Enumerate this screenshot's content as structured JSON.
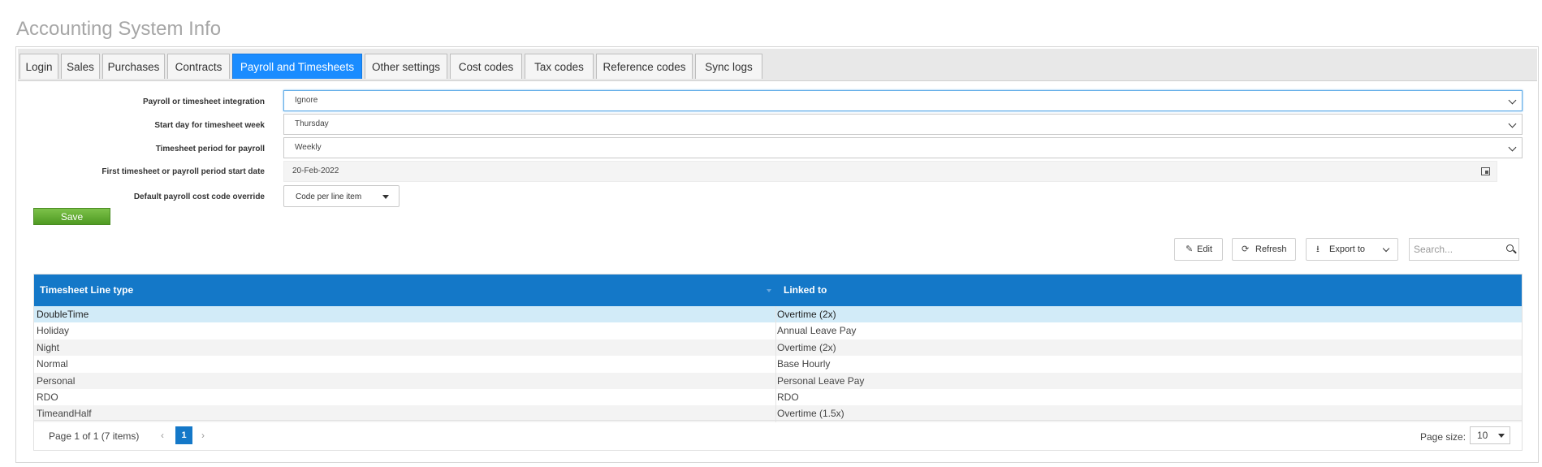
{
  "page": {
    "title": "Accounting System Info"
  },
  "tabs": [
    {
      "label": "Login",
      "active": false
    },
    {
      "label": "Sales",
      "active": false
    },
    {
      "label": "Purchases",
      "active": false
    },
    {
      "label": "Contracts",
      "active": false
    },
    {
      "label": "Payroll and Timesheets",
      "active": true
    },
    {
      "label": "Other settings",
      "active": false
    },
    {
      "label": "Cost codes",
      "active": false
    },
    {
      "label": "Tax codes",
      "active": false
    },
    {
      "label": "Reference codes",
      "active": false
    },
    {
      "label": "Sync logs",
      "active": false
    }
  ],
  "form": {
    "payroll_integration": {
      "label": "Payroll or timesheet integration",
      "value": "Ignore"
    },
    "start_day": {
      "label": "Start day for timesheet week",
      "value": "Thursday"
    },
    "period": {
      "label": "Timesheet period for payroll",
      "value": "Weekly"
    },
    "first_date": {
      "label": "First timesheet or payroll period start date",
      "value": "20-Feb-2022"
    },
    "cost_code_override": {
      "label": "Default payroll cost code override",
      "value": "Code per line item"
    },
    "save_label": "Save"
  },
  "toolbar": {
    "edit_label": "Edit",
    "refresh_label": "Refresh",
    "export_label": "Export to",
    "search_placeholder": "Search..."
  },
  "grid": {
    "columns": [
      "Timesheet Line type",
      "Linked to"
    ],
    "rows": [
      [
        "DoubleTime",
        "Overtime (2x)"
      ],
      [
        "Holiday",
        "Annual Leave Pay"
      ],
      [
        "Night",
        "Overtime (2x)"
      ],
      [
        "Normal",
        "Base Hourly"
      ],
      [
        "Personal",
        "Personal Leave Pay"
      ],
      [
        "RDO",
        "RDO"
      ],
      [
        "TimeandHalf",
        "Overtime (1.5x)"
      ]
    ],
    "selected_row": 0
  },
  "pager": {
    "info": "Page 1 of 1 (7 items)",
    "current_page": "1",
    "page_size_label": "Page size:",
    "page_size": "10"
  },
  "colors": {
    "accent": "#1478c8",
    "active_tab": "#1a8cff",
    "save_green": "#5aa82a",
    "selected_row": "#d2ebf8"
  }
}
